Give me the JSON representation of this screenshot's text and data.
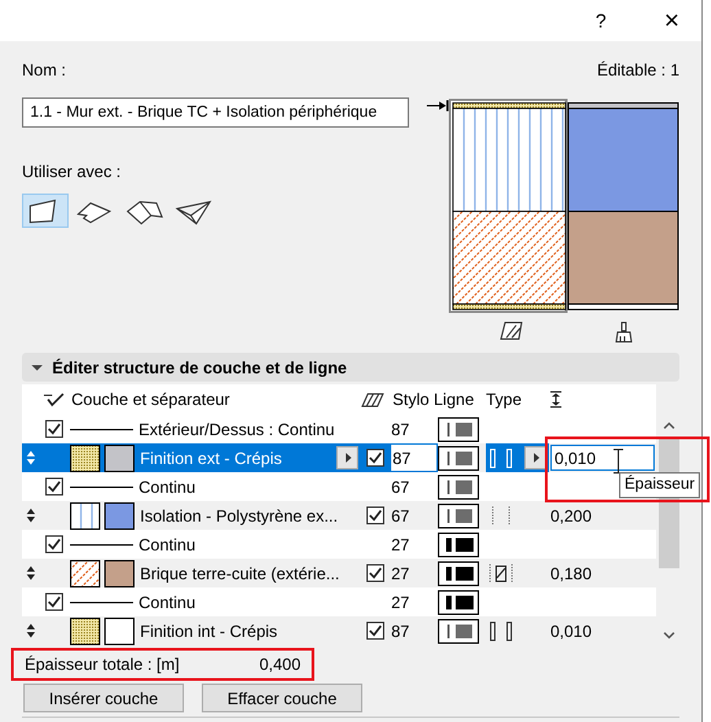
{
  "window": {
    "help": "?",
    "close": "×"
  },
  "name_label": "Nom :",
  "editable": "Éditable : 1",
  "name_value": "1.1 - Mur ext. - Brique TC + Isolation périphérique",
  "use_with_label": "Utiliser avec :",
  "use_with": [
    {
      "kind": "wall",
      "selected": true
    },
    {
      "kind": "slab",
      "selected": false
    },
    {
      "kind": "roof",
      "selected": false
    },
    {
      "kind": "shell",
      "selected": false
    }
  ],
  "section": {
    "title": "Éditer structure de couche et de ligne",
    "expanded": true
  },
  "table": {
    "columns": [
      "Couche et séparateur",
      "Stylo Ligne",
      "Type"
    ],
    "rows": [
      {
        "kind": "separator",
        "selected": false,
        "checked": true,
        "label": "Extérieur/Dessus : Continu",
        "pen": "87",
        "line_sample": {
          "kind": "thin"
        }
      },
      {
        "kind": "layer",
        "selected": true,
        "fill": {
          "kind": "dots"
        },
        "color": "#c3c3c8",
        "name": "Finition ext - Crépis",
        "checked": true,
        "pen": "87",
        "line_sample": {
          "kind": "thin"
        },
        "type_icon": {
          "kind": "outline"
        },
        "thickness": "0,010"
      },
      {
        "kind": "separator",
        "selected": false,
        "checked": true,
        "label": "Continu",
        "pen": "67",
        "line_sample": {
          "kind": "thin"
        }
      },
      {
        "kind": "layer",
        "selected": false,
        "fill": {
          "kind": "lines"
        },
        "color": "#7b98e2",
        "name": "Isolation - Polystyrène ex...",
        "checked": true,
        "pen": "67",
        "line_sample": {
          "kind": "thin"
        },
        "type_icon": {
          "kind": "dashed"
        },
        "thickness": "0,200"
      },
      {
        "kind": "separator",
        "selected": false,
        "checked": true,
        "label": "Continu",
        "pen": "27",
        "line_sample": {
          "kind": "thick"
        }
      },
      {
        "kind": "layer",
        "selected": false,
        "fill": {
          "kind": "hatch"
        },
        "color": "#c4a08a",
        "name": "Brique terre-cuite (extérie...",
        "checked": true,
        "pen": "27",
        "line_sample": {
          "kind": "thick"
        },
        "type_icon": {
          "kind": "hatched"
        },
        "thickness": "0,180"
      },
      {
        "kind": "separator",
        "selected": false,
        "checked": true,
        "label": "Continu",
        "pen": "27",
        "line_sample": {
          "kind": "thick"
        }
      },
      {
        "kind": "layer",
        "selected": false,
        "fill": {
          "kind": "dots"
        },
        "color": "#ffffff",
        "name": "Finition int - Crépis",
        "checked": true,
        "pen": "87",
        "line_sample": {
          "kind": "thin"
        },
        "type_icon": {
          "kind": "outline"
        },
        "thickness": "0,010"
      }
    ]
  },
  "tooltip": "Épaisseur",
  "total_label": "Épaisseur totale : [m]",
  "total_value": "0,400",
  "buttons": [
    "Insérer couche",
    "Effacer couche"
  ]
}
